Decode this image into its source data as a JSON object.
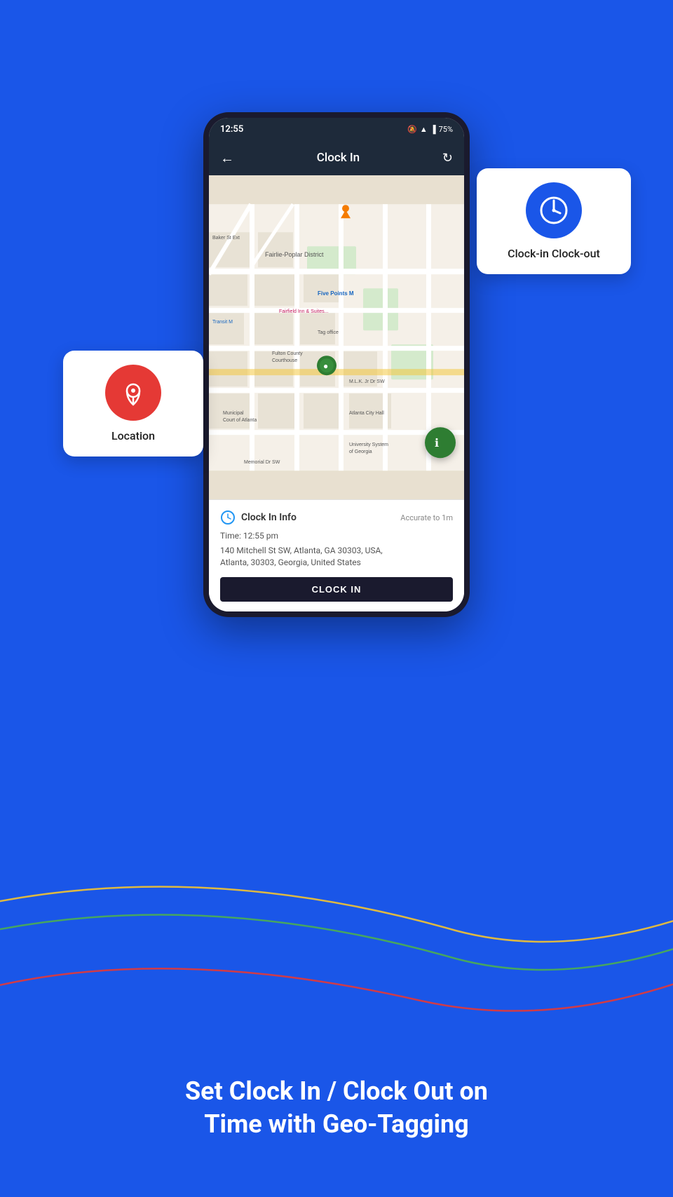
{
  "background_color": "#1a56e8",
  "status_bar": {
    "time": "12:55",
    "battery": "75%"
  },
  "app_bar": {
    "title": "Clock In",
    "back_icon": "←",
    "refresh_icon": "↻"
  },
  "map": {
    "pin_label": "●",
    "labels": [
      {
        "text": "Fairlie-Poplar District",
        "type": "blue"
      },
      {
        "text": "Five Points",
        "type": "blue"
      },
      {
        "text": "Fairfield Inn & Suites by Marriott...",
        "type": "pink"
      },
      {
        "text": "Tag office",
        "type": "default"
      },
      {
        "text": "Fulton County Courthouse",
        "type": "default"
      },
      {
        "text": "Atlanta City Hall",
        "type": "default"
      },
      {
        "text": "Municipal Court of Atlanta",
        "type": "default"
      },
      {
        "text": "University System of Georgia",
        "type": "default"
      },
      {
        "text": "Memorial Dr SW",
        "type": "default"
      }
    ]
  },
  "clock_info": {
    "title": "Clock In Info",
    "accuracy": "Accurate to 1m",
    "time_label": "Time: 12:55 pm",
    "address_line1": "140 Mitchell St SW, Atlanta, GA 30303, USA,",
    "address_line2": "Atlanta, 30303, Georgia, United States",
    "button_label": "CLOCK IN"
  },
  "location_card": {
    "label": "Location"
  },
  "clockio_card": {
    "label": "Clock-in Clock-out"
  },
  "bottom_text": {
    "line1": "Set Clock In / Clock Out on",
    "line2": "Time with Geo-Tagging"
  },
  "deco_colors": {
    "yellow": "#f4c430",
    "green": "#4caf50",
    "red": "#e53935",
    "teal": "#26c6da"
  }
}
